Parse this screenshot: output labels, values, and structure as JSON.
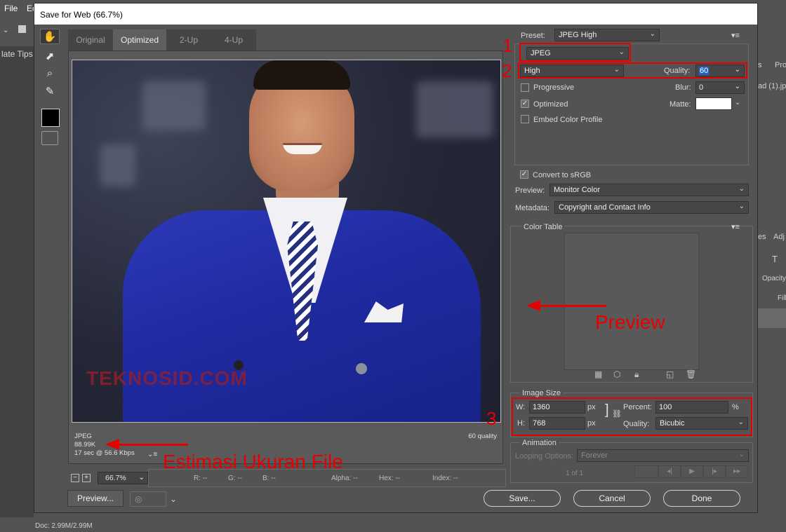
{
  "app": {
    "menu": [
      "File",
      "Ec"
    ],
    "left_tab_label": "late Tips 7",
    "status_text": "Doc: 2.99M/2.99M"
  },
  "right_edge": {
    "tab_a": "s",
    "tab_b": "Pro",
    "file_label": "ad (1).jpg",
    "tab_c": "es",
    "tab_d": "Adj",
    "opacity": "Opacity",
    "fill": "Fill",
    "type_icon": "T"
  },
  "dialog": {
    "title": "Save for Web (66.7%)",
    "tabs": [
      "Original",
      "Optimized",
      "2-Up",
      "4-Up"
    ],
    "active_tab": "Optimized",
    "tools": [
      "hand-icon",
      "slice-select-icon",
      "zoom-icon",
      "eyedropper-icon",
      "color-swatch",
      "toggle-slices-icon"
    ],
    "image_watermark": "TEKNOSID.COM",
    "preview_info": {
      "format": "JPEG",
      "size": "88.99K",
      "time": "17 sec @ 56.6 Kbps",
      "quality": "60 quality"
    },
    "zoom": "66.7%",
    "pixel_info": {
      "r": "R: --",
      "g": "G: --",
      "b": "B: --",
      "alpha": "Alpha: --",
      "hex": "Hex: --",
      "index": "Index: --"
    },
    "buttons": {
      "preview": "Preview...",
      "save": "Save...",
      "cancel": "Cancel",
      "done": "Done"
    }
  },
  "settings": {
    "preset_label": "Preset:",
    "preset_value": "JPEG High",
    "format_value": "JPEG",
    "quality_preset": "High",
    "quality_label": "Quality:",
    "quality_value": "60",
    "progressive_label": "Progressive",
    "progressive_checked": false,
    "blur_label": "Blur:",
    "blur_value": "0",
    "optimized_label": "Optimized",
    "optimized_checked": true,
    "matte_label": "Matte:",
    "embed_label": "Embed Color Profile",
    "embed_checked": false,
    "convert_label": "Convert to sRGB",
    "convert_checked": true,
    "preview_label": "Preview:",
    "preview_value": "Monitor Color",
    "metadata_label": "Metadata:",
    "metadata_value": "Copyright and Contact Info"
  },
  "color_table": {
    "title": "Color Table"
  },
  "image_size": {
    "title": "Image Size",
    "w_label": "W:",
    "w_value": "1360",
    "h_label": "H:",
    "h_value": "768",
    "unit": "px",
    "percent_label": "Percent:",
    "percent_value": "100",
    "percent_unit": "%",
    "quality_label": "Quality:",
    "quality_value": "Bicubic"
  },
  "animation": {
    "title": "Animation",
    "looping_label": "Looping Options:",
    "looping_value": "Forever",
    "frame_counter": "1 of 1"
  },
  "annotations": {
    "n1": "1",
    "n2": "2",
    "n3": "3",
    "preview_text": "Preview",
    "filesize_text": "Estimasi Ukuran File",
    "color": "#e60000"
  }
}
